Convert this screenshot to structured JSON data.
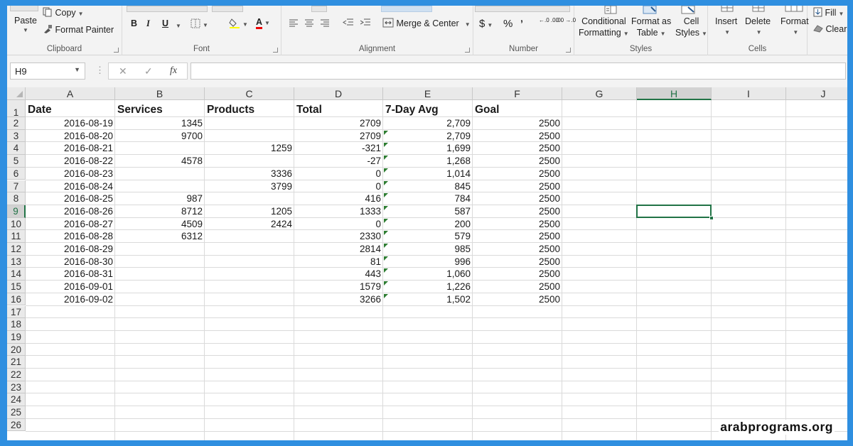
{
  "ribbon": {
    "clipboard": {
      "label": "Clipboard",
      "paste": "Paste",
      "copy": "Copy",
      "format_painter": "Format Painter"
    },
    "font": {
      "label": "Font",
      "bold": "B",
      "italic": "I",
      "underline": "U",
      "font_color_glyph": "A"
    },
    "alignment": {
      "label": "Alignment",
      "merge_center": "Merge & Center"
    },
    "number": {
      "label": "Number",
      "currency": "$",
      "percent": "%",
      "comma": "’",
      "inc_decimal": "←.0 .00",
      "dec_decimal": ".00 →.0"
    },
    "styles": {
      "label": "Styles",
      "conditional_1": "Conditional",
      "conditional_2": "Formatting",
      "format_table_1": "Format as",
      "format_table_2": "Table",
      "cell_styles_1": "Cell",
      "cell_styles_2": "Styles"
    },
    "cells": {
      "label": "Cells",
      "insert": "Insert",
      "delete": "Delete",
      "format": "Format"
    },
    "editing": {
      "fill": "Fill",
      "clear": "Clear"
    }
  },
  "formula_bar": {
    "name_box": "H9",
    "cancel": "✕",
    "enter": "✓",
    "fx": "fx",
    "formula": ""
  },
  "columns": [
    "A",
    "B",
    "C",
    "D",
    "E",
    "F",
    "G",
    "H",
    "I",
    "J"
  ],
  "selected_column": "H",
  "selected_row": 9,
  "rows": [
    "1",
    "2",
    "3",
    "4",
    "5",
    "6",
    "7",
    "8",
    "9",
    "10",
    "11",
    "12",
    "13",
    "14",
    "15",
    "16",
    "17",
    "18",
    "19",
    "20",
    "21",
    "22",
    "23",
    "24",
    "25",
    "26"
  ],
  "headers": {
    "a": "Date",
    "b": "Services",
    "c": "Products",
    "d": "Total",
    "e": "7-Day Avg",
    "f": "Goal"
  },
  "data": [
    {
      "date": "2016-08-19",
      "services": "1345",
      "products": "",
      "total": "2709",
      "avg": "2,709",
      "goal": "2500"
    },
    {
      "date": "2016-08-20",
      "services": "9700",
      "products": "",
      "total": "2709",
      "avg": "2,709",
      "goal": "2500"
    },
    {
      "date": "2016-08-21",
      "services": "",
      "products": "1259",
      "total": "-321",
      "avg": "1,699",
      "goal": "2500"
    },
    {
      "date": "2016-08-22",
      "services": "4578",
      "products": "",
      "total": "-27",
      "avg": "1,268",
      "goal": "2500"
    },
    {
      "date": "2016-08-23",
      "services": "",
      "products": "3336",
      "total": "0",
      "avg": "1,014",
      "goal": "2500"
    },
    {
      "date": "2016-08-24",
      "services": "",
      "products": "3799",
      "total": "0",
      "avg": "845",
      "goal": "2500"
    },
    {
      "date": "2016-08-25",
      "services": "987",
      "products": "",
      "total": "416",
      "avg": "784",
      "goal": "2500"
    },
    {
      "date": "2016-08-26",
      "services": "8712",
      "products": "1205",
      "total": "1333",
      "avg": "587",
      "goal": "2500"
    },
    {
      "date": "2016-08-27",
      "services": "4509",
      "products": "2424",
      "total": "0",
      "avg": "200",
      "goal": "2500"
    },
    {
      "date": "2016-08-28",
      "services": "6312",
      "products": "",
      "total": "2330",
      "avg": "579",
      "goal": "2500"
    },
    {
      "date": "2016-08-29",
      "services": "",
      "products": "",
      "total": "2814",
      "avg": "985",
      "goal": "2500"
    },
    {
      "date": "2016-08-30",
      "services": "",
      "products": "",
      "total": "81",
      "avg": "996",
      "goal": "2500"
    },
    {
      "date": "2016-08-31",
      "services": "",
      "products": "",
      "total": "443",
      "avg": "1,060",
      "goal": "2500"
    },
    {
      "date": "2016-09-01",
      "services": "",
      "products": "",
      "total": "1579",
      "avg": "1,226",
      "goal": "2500"
    },
    {
      "date": "2016-09-02",
      "services": "",
      "products": "",
      "total": "3266",
      "avg": "1,502",
      "goal": "2500"
    }
  ],
  "watermark": "arabprograms.org",
  "colors": {
    "accent": "#217346",
    "frame": "#2f8fe0",
    "error_indicator": "#2e7d32"
  }
}
